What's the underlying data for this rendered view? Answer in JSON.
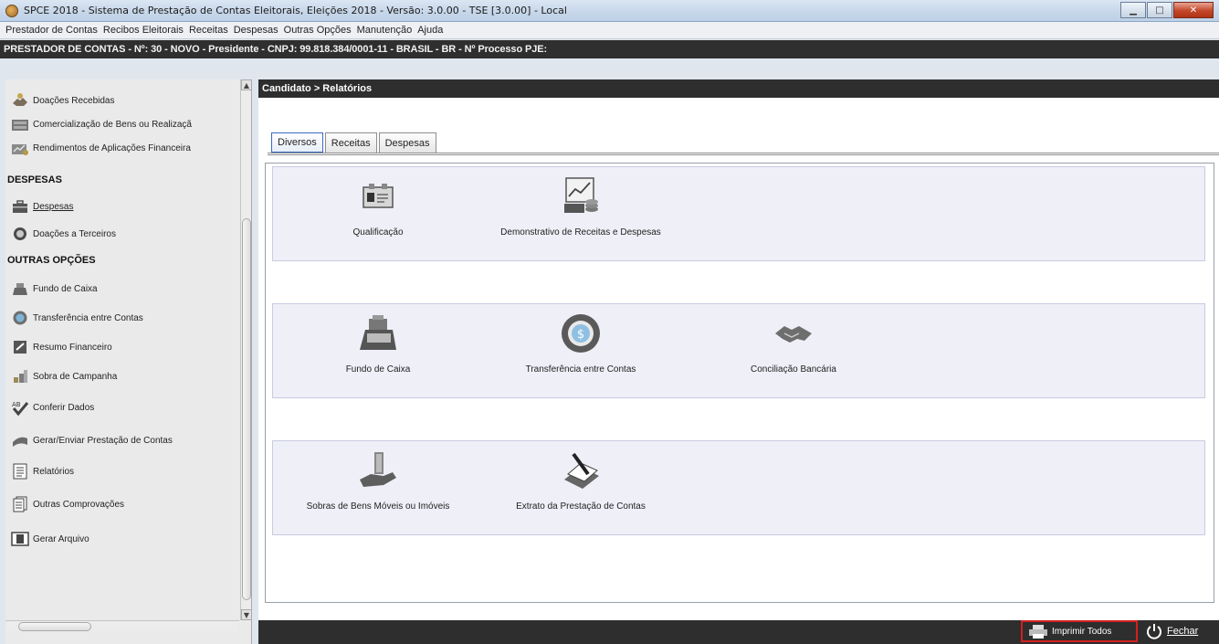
{
  "window": {
    "title": "SPCE 2018 - Sistema de Prestação de Contas Eleitorais, Eleições 2018 - Versão: 3.0.00  -  TSE [3.0.00] - Local"
  },
  "menu": [
    "Prestador de Contas",
    "Recibos Eleitorais",
    "Receitas",
    "Despesas",
    "Outras Opções",
    "Manutenção",
    "Ajuda"
  ],
  "infobar": "PRESTADOR DE CONTAS - Nº: 30 - NOVO - Presidente -  CNPJ: 99.818.384/0001-11 - BRASIL - BR - Nº Processo PJE:",
  "sidebar": {
    "items_top": [
      "Doações Recebidas",
      "Comercialização de Bens ou Realizaçã",
      "Rendimentos de Aplicações Financeira"
    ],
    "section_despesas": "DESPESAS",
    "items_despesas": [
      "Despesas",
      "Doações a Terceiros"
    ],
    "section_outras": "OUTRAS OPÇÕES",
    "items_outras": [
      "Fundo de Caixa",
      "Transferência entre Contas",
      "Resumo Financeiro",
      "Sobra de Campanha",
      "Conferir Dados",
      "Gerar/Enviar Prestação de Contas",
      "Relatórios",
      "Outras Comprovações",
      "Gerar Arquivo"
    ]
  },
  "main": {
    "breadcrumb": "Candidato > Relatórios",
    "tabs": [
      "Diversos",
      "Receitas",
      "Despesas"
    ],
    "groups": [
      [
        "Qualificação",
        "Demonstrativo de Receitas e Despesas"
      ],
      [
        "Fundo de Caixa",
        "Transferência entre Contas",
        "Conciliação Bancária"
      ],
      [
        "Sobras de Bens Móveis ou Imóveis",
        "Extrato da Prestação de Contas"
      ]
    ]
  },
  "footer": {
    "print_all": "Imprimir Todos",
    "close": "Fechar"
  }
}
